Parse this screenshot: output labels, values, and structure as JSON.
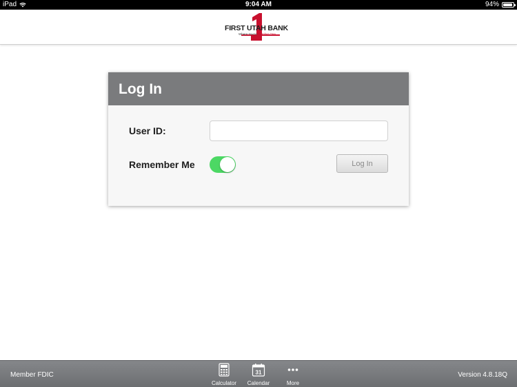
{
  "status_bar": {
    "carrier": "iPad",
    "time": "9:04 AM",
    "battery": "94%",
    "battery_level": 0.94
  },
  "header": {
    "logo_text": "FIRST UTAH BANK",
    "logo_tagline_prefix": "Where You're ",
    "logo_tagline_highlight": "Number One",
    "brand_red": "#c8102e"
  },
  "login": {
    "title": "Log In",
    "user_id_label": "User ID:",
    "user_id_value": "",
    "user_id_placeholder": "",
    "remember_label": "Remember Me",
    "remember_on": true,
    "button_label": "Log In"
  },
  "footer": {
    "member": "Member FDIC",
    "version": "Version 4.8.18Q",
    "tabs": [
      {
        "label": "Calculator",
        "icon": "calculator-icon"
      },
      {
        "label": "Calendar",
        "icon": "calendar-icon",
        "day": "31"
      },
      {
        "label": "More",
        "icon": "more-icon"
      }
    ]
  },
  "colors": {
    "toggle_on": "#4cd864",
    "panel_header": "#7a7b7d"
  }
}
